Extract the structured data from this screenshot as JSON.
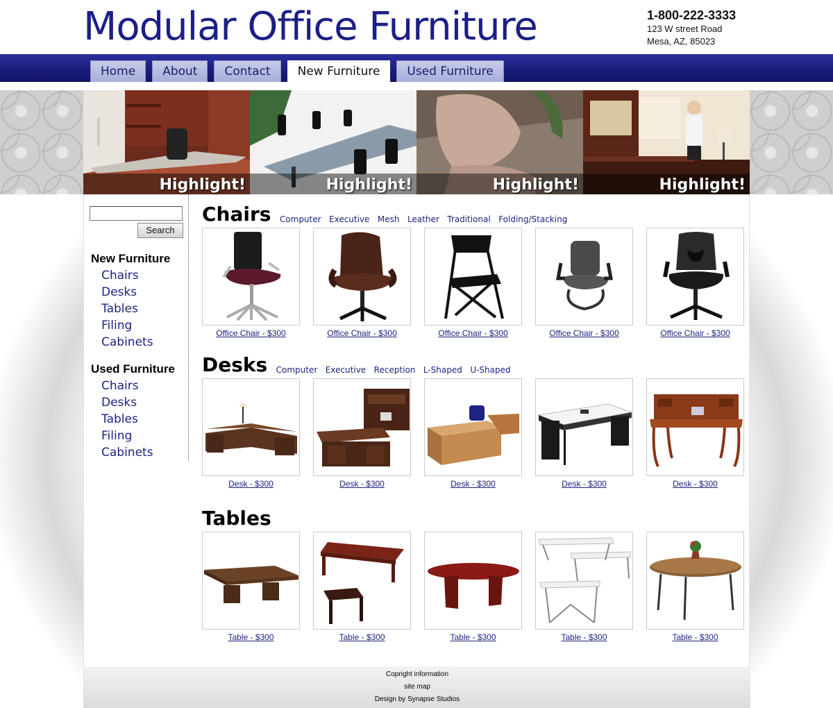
{
  "header": {
    "logo": "Modular Office Furniture",
    "phone": "1-800-222-3333",
    "address_line1": "123 W street Road",
    "address_line2": "Mesa, AZ, 85023"
  },
  "nav": {
    "tabs": [
      {
        "label": "Home",
        "active": false
      },
      {
        "label": "About",
        "active": false
      },
      {
        "label": "Contact",
        "active": false
      },
      {
        "label": "New Furniture",
        "active": true
      },
      {
        "label": "Used Furniture",
        "active": false
      }
    ]
  },
  "banner": {
    "panels": [
      {
        "label": "Highlight!"
      },
      {
        "label": "Highlight!"
      },
      {
        "label": "Highlight!"
      },
      {
        "label": "Highlight!"
      }
    ]
  },
  "sidebar": {
    "search_value": "",
    "search_button": "Search",
    "new_heading": "New Furniture",
    "new_links": [
      "Chairs",
      "Desks",
      "Tables",
      "Filing",
      "Cabinets"
    ],
    "used_heading": "Used Furniture",
    "used_links": [
      "Chairs",
      "Desks",
      "Tables",
      "Filing",
      "Cabinets"
    ]
  },
  "sections": [
    {
      "title": "Chairs",
      "subcategories": [
        "Computer",
        "Executive",
        "Mesh",
        "Leather",
        "Traditional",
        "Folding/Stacking"
      ],
      "products": [
        {
          "caption": "Office Chair - $300",
          "icon": "task-chair-icon"
        },
        {
          "caption": "Office Chair - $300",
          "icon": "leather-chair-icon"
        },
        {
          "caption": "Office Chair - $300",
          "icon": "folding-chair-icon"
        },
        {
          "caption": "Office Chair - $300",
          "icon": "guest-chair-icon"
        },
        {
          "caption": "Office Chair - $300",
          "icon": "mesh-chair-icon"
        }
      ]
    },
    {
      "title": "Desks",
      "subcategories": [
        "Computer",
        "Executive",
        "Reception",
        "L-Shaped",
        "U-Shaped"
      ],
      "products": [
        {
          "caption": "Desk - $300",
          "icon": "l-desk-icon"
        },
        {
          "caption": "Desk - $300",
          "icon": "executive-desk-icon"
        },
        {
          "caption": "Desk - $300",
          "icon": "reception-desk-icon"
        },
        {
          "caption": "Desk - $300",
          "icon": "steel-desk-icon"
        },
        {
          "caption": "Desk - $300",
          "icon": "writing-desk-icon"
        }
      ]
    },
    {
      "title": "Tables",
      "subcategories": [],
      "products": [
        {
          "caption": "Table - $300",
          "icon": "conference-table-icon"
        },
        {
          "caption": "Table - $300",
          "icon": "coffee-table-icon"
        },
        {
          "caption": "Table - $300",
          "icon": "oval-table-icon"
        },
        {
          "caption": "Table - $300",
          "icon": "folding-table-icon"
        },
        {
          "caption": "Table - $300",
          "icon": "round-table-icon"
        }
      ]
    }
  ],
  "footer": {
    "copyright": "Copright information",
    "sitemap": "site map",
    "credit": "Design by Synapse Studios"
  },
  "colors": {
    "brand_blue": "#1c1f86",
    "link_blue": "#1e2380",
    "nav_bar": "#1a1d7a"
  }
}
